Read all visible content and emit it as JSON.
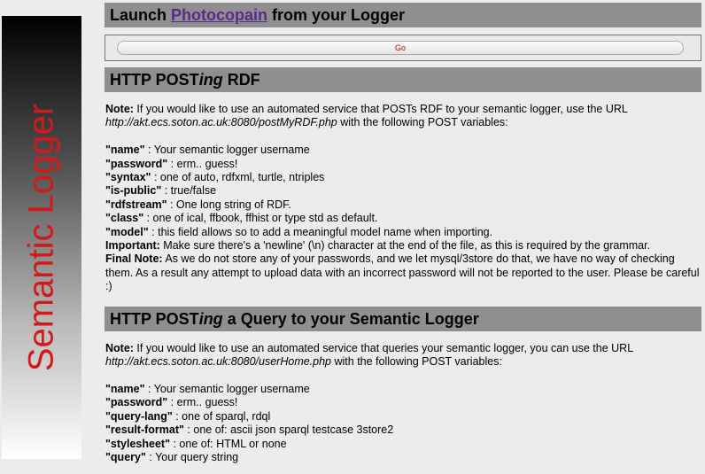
{
  "sidebar": {
    "title": "Semantic Logger"
  },
  "launch": {
    "heading_prefix": "Launch ",
    "heading_link": "Photocopain",
    "heading_suffix": " from your Logger",
    "button_label": "Go"
  },
  "rdf": {
    "heading_a": "HTTP POST",
    "heading_b": "ing",
    "heading_c": " RDF",
    "note_label": "Note:",
    "note_text": " If you would like to use an automated service that POSTs RDF to your semantic logger, use the URL",
    "url": "http://akt.ecs.soton.ac.uk:8080/postMyRDF.php",
    "url_suffix": " with the following POST variables:",
    "vars": [
      {
        "name": "\"name\"",
        "desc": " : Your semantic logger username"
      },
      {
        "name": "\"password\"",
        "desc": " : erm.. guess!"
      },
      {
        "name": "\"syntax\"",
        "desc": " : one of auto, rdfxml, turtle, ntriples"
      },
      {
        "name": "\"is-public\"",
        "desc": " : true/false"
      },
      {
        "name": "\"rdfstream\"",
        "desc": " : One long string of RDF."
      },
      {
        "name": "\"class\"",
        "desc": " : one of ical, ffbook, ffhist or type std as default."
      },
      {
        "name": "\"model\"",
        "desc": " : this field allows so to add a meaningful model name when importing."
      },
      {
        "name": "Important:",
        "desc": " Make sure there's a 'newline' (\\n) character at the end of the file, as this is required by the grammar."
      },
      {
        "name": "Final Note:",
        "desc": " As we do not store any of your passwords, and we let mysql/3store do that, we have no way of checking them. As a result any attempt to upload data with an incorrect password will not be reported to the user. Please be careful :)"
      }
    ]
  },
  "query": {
    "heading_a": "HTTP POST",
    "heading_b": "ing",
    "heading_c": " a Query to your Semantic Logger",
    "note_label": "Note:",
    "note_text": " If you would like to use an automated service that queries your semantic logger, you can use the URL",
    "url": "http://akt.ecs.soton.ac.uk:8080/userHome.php",
    "url_suffix": " with the following POST variables:",
    "vars": [
      {
        "name": "\"name\"",
        "desc": " : Your semantic logger username"
      },
      {
        "name": "\"password\"",
        "desc": " : erm.. guess!"
      },
      {
        "name": "\"query-lang\"",
        "desc": " : one of sparql, rdql"
      },
      {
        "name": "\"result-format\"",
        "desc": " : one of: ascii json sparql testcase 3store2"
      },
      {
        "name": "\"stylesheet\"",
        "desc": " : one of: HTML or none"
      },
      {
        "name": "\"query\"",
        "desc": " : Your query string"
      }
    ]
  },
  "colors": {
    "heading_bg": "#8f8f8f",
    "page_bg": "#ececec",
    "sidebar_title": "#d11a1a",
    "link": "#5a2a8e",
    "button_text": "#bb0000"
  }
}
